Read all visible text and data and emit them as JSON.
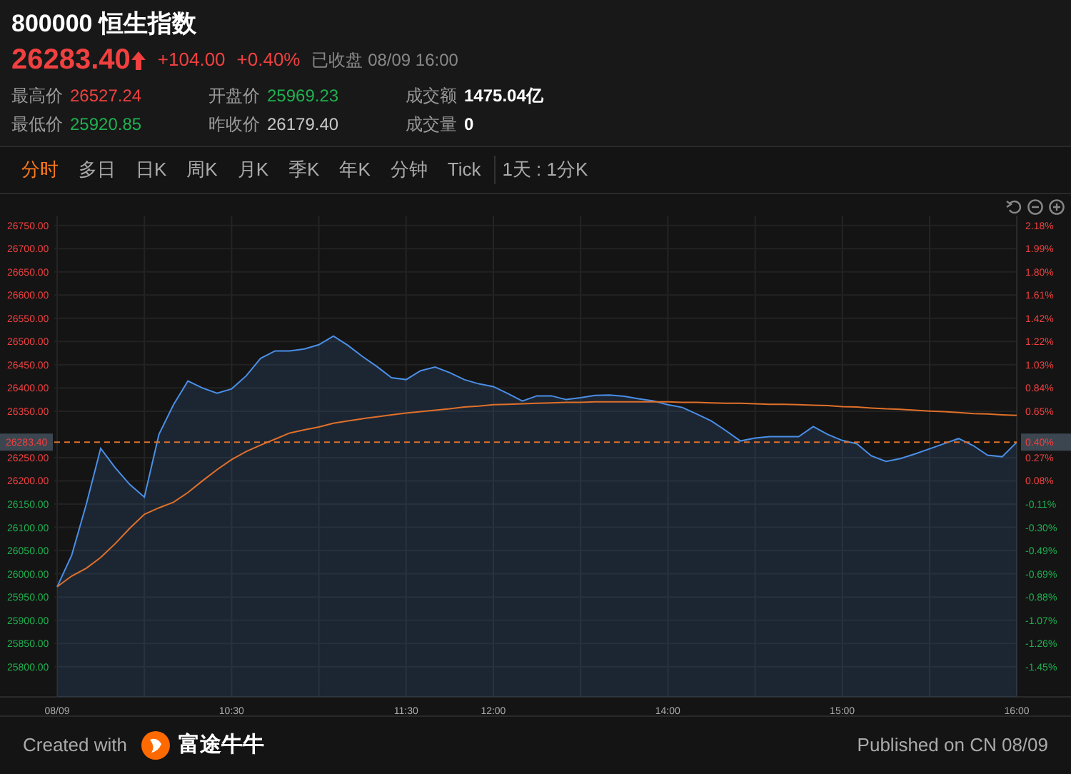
{
  "header": {
    "title": "800000 恒生指数",
    "price": "26283.40",
    "change": "+104.00",
    "change_pct": "+0.40%",
    "status": "已收盘 08/09 16:00"
  },
  "stats": [
    {
      "label": "最高价",
      "value": "26527.24",
      "kind": "up"
    },
    {
      "label": "开盘价",
      "value": "25969.23",
      "kind": "down"
    },
    {
      "label": "成交额",
      "value": "1475.04亿",
      "kind": "plain"
    },
    {
      "label": "最低价",
      "value": "25920.85",
      "kind": "down"
    },
    {
      "label": "昨收价",
      "value": "26179.40",
      "kind": "neutral"
    },
    {
      "label": "成交量",
      "value": "0",
      "kind": "plain"
    }
  ],
  "tabs": [
    {
      "label": "分时",
      "selected": true
    },
    {
      "label": "多日",
      "selected": false
    },
    {
      "label": "日K",
      "selected": false
    },
    {
      "label": "周K",
      "selected": false
    },
    {
      "label": "月K",
      "selected": false
    },
    {
      "label": "季K",
      "selected": false
    },
    {
      "label": "年K",
      "selected": false
    },
    {
      "label": "分钟",
      "selected": false
    },
    {
      "label": "Tick",
      "selected": false
    }
  ],
  "period": "1天 : 1分K",
  "chart": {
    "percent_labels": [
      {
        "label": "2.18%",
        "kind": "up"
      },
      {
        "label": "1.99%",
        "kind": "up"
      },
      {
        "label": "1.80%",
        "kind": "up"
      },
      {
        "label": "1.61%",
        "kind": "up"
      },
      {
        "label": "1.42%",
        "kind": "up"
      },
      {
        "label": "1.22%",
        "kind": "up"
      },
      {
        "label": "1.03%",
        "kind": "up"
      },
      {
        "label": "0.84%",
        "kind": "up"
      },
      {
        "label": "0.65%",
        "kind": "up"
      },
      {
        "label": "0.27%",
        "kind": "up"
      },
      {
        "label": "0.08%",
        "kind": "up"
      },
      {
        "label": "-0.11%",
        "kind": "down"
      },
      {
        "label": "-0.30%",
        "kind": "down"
      },
      {
        "label": "-0.49%",
        "kind": "down"
      },
      {
        "label": "-0.69%",
        "kind": "down"
      },
      {
        "label": "-0.88%",
        "kind": "down"
      },
      {
        "label": "-1.07%",
        "kind": "down"
      },
      {
        "label": "-1.26%",
        "kind": "down"
      },
      {
        "label": "-1.45%",
        "kind": "down"
      }
    ],
    "current_marker": {
      "percent": "0.40%"
    },
    "chart_data": {
      "type": "area",
      "grid": true,
      "categories": [
        "08/09",
        null,
        null,
        null,
        null,
        null,
        null,
        null,
        null,
        null,
        null,
        null,
        "10:30",
        null,
        null,
        null,
        null,
        null,
        null,
        null,
        null,
        null,
        null,
        null,
        "11:30",
        null,
        null,
        null,
        null,
        null,
        "12:00",
        null,
        null,
        null,
        null,
        null,
        null,
        null,
        null,
        null,
        null,
        null,
        "14:00",
        null,
        null,
        null,
        null,
        null,
        null,
        null,
        null,
        null,
        null,
        null,
        "15:00",
        null,
        null,
        null,
        null,
        null,
        null,
        null,
        null,
        null,
        null,
        null,
        "16:00"
      ],
      "series": [
        {
          "color": "#4a8fe7",
          "values": [
            25972,
            26040,
            26149,
            26270,
            26228,
            26192,
            26165,
            26300,
            26364,
            26415,
            26400,
            26389,
            26398,
            26426,
            26464,
            26480,
            26480,
            26484,
            26493,
            26512,
            26492,
            26468,
            26446,
            26422,
            26418,
            26437,
            26445,
            26433,
            26418,
            26409,
            26403,
            26388,
            26372,
            26383,
            26383,
            26375,
            26379,
            26384,
            26385,
            26382,
            26377,
            26372,
            26364,
            26358,
            26344,
            26329,
            26308,
            26286,
            26292,
            26295,
            26295,
            26295,
            26317,
            26300,
            26287,
            26280,
            26254,
            26242,
            26248,
            26258,
            26269,
            26280,
            26291,
            26276,
            26255,
            26252,
            26283
          ]
        },
        {
          "type": "line",
          "color": "#e0702a",
          "values": [
            25972,
            25995,
            26012,
            26035,
            26065,
            26098,
            26128,
            26142,
            26154,
            26175,
            26200,
            26224,
            26246,
            26263,
            26277,
            26290,
            26303,
            26310,
            26316,
            26324,
            26329,
            26334,
            26338,
            26342,
            26346,
            26349,
            26352,
            26355,
            26359,
            26361,
            26364,
            26365,
            26366,
            26367,
            26368,
            26369,
            26369,
            26370,
            26370,
            26370,
            26370,
            26370,
            26370,
            26369,
            26369,
            26368,
            26367,
            26367,
            26366,
            26365,
            26365,
            26364,
            26363,
            26362,
            26360,
            26359,
            26357,
            26355,
            26354,
            26352,
            26350,
            26349,
            26347,
            26345,
            26344,
            26342,
            26341
          ]
        }
      ],
      "ylim": [
        25735,
        26771
      ],
      "yticks": [
        {
          "value": 26750,
          "label": "26750.00"
        },
        {
          "value": 26700,
          "label": "26700.00"
        },
        {
          "value": 26650,
          "label": "26650.00"
        },
        {
          "value": 26600,
          "label": "26600.00"
        },
        {
          "value": 26550,
          "label": "26550.00"
        },
        {
          "value": 26500,
          "label": "26500.00"
        },
        {
          "value": 26450,
          "label": "26450.00"
        },
        {
          "value": 26400,
          "label": "26400.00"
        },
        {
          "value": 26350,
          "label": "26350.00"
        },
        {
          "value": 26250,
          "label": "26250.00"
        },
        {
          "value": 26200,
          "label": "26200.00"
        },
        {
          "value": 26150,
          "label": "26150.00"
        },
        {
          "value": 26100,
          "label": "26100.00"
        },
        {
          "value": 26050,
          "label": "26050.00"
        },
        {
          "value": 26000,
          "label": "26000.00"
        },
        {
          "value": 25950,
          "label": "25950.00"
        },
        {
          "value": 25900,
          "label": "25900.00"
        },
        {
          "value": 25850,
          "label": "25850.00"
        },
        {
          "value": 25800,
          "label": "25800.00"
        }
      ],
      "ref_lines": [
        {
          "axis": "y",
          "value": 26283.4,
          "label": "26283.40",
          "color": "#e0702a"
        }
      ]
    }
  },
  "footer": {
    "created_with": "Created with",
    "brand": "富途牛牛",
    "published": "Published on CN 08/09"
  }
}
